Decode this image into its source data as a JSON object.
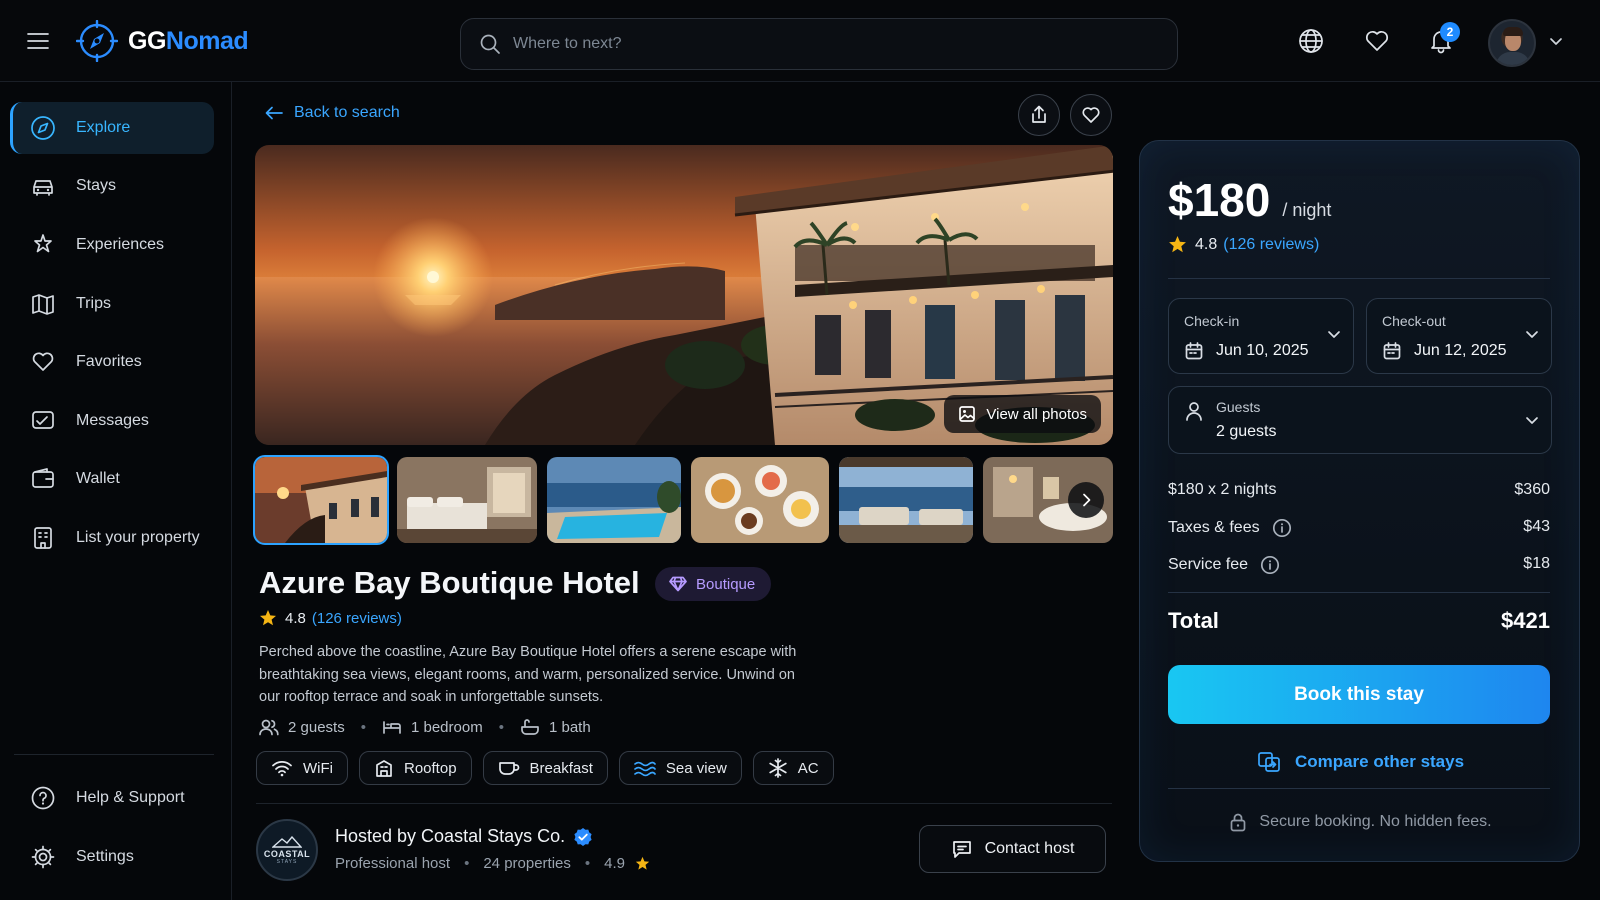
{
  "app": {
    "brand_part1": "GG",
    "brand_part2": "Nomad",
    "accent_color": "#2b8cff"
  },
  "search": {
    "placeholder": "Where to next?",
    "value": ""
  },
  "header": {
    "notification_count": "2",
    "icons": [
      "menu-icon",
      "globe-icon",
      "heart-icon",
      "bell-icon",
      "avatar",
      "chevron-down-icon"
    ]
  },
  "sidebar": {
    "items": [
      {
        "label": "Explore",
        "icon": "compass-icon",
        "active": true
      },
      {
        "label": "Stays",
        "icon": "car-icon"
      },
      {
        "label": "Experiences",
        "icon": "sparkle-icon"
      },
      {
        "label": "Trips",
        "icon": "map-icon"
      },
      {
        "label": "Favorites",
        "icon": "heart-icon"
      },
      {
        "label": "Messages",
        "icon": "message-icon"
      },
      {
        "label": "Wallet",
        "icon": "wallet-icon"
      },
      {
        "label": "List your property",
        "icon": "building-icon"
      }
    ],
    "bottom_items": [
      {
        "label": "Help & Support",
        "icon": "help-icon"
      },
      {
        "label": "Settings",
        "icon": "gear-icon"
      }
    ]
  },
  "listing": {
    "back_label": "Back to search",
    "view_all_label": "View all photos",
    "title": "Azure Bay Boutique Hotel",
    "tag": "Boutique",
    "rating": "4.8",
    "reviews": "(126 reviews)",
    "description": "Perched above the coastline, Azure Bay Boutique Hotel offers a serene escape with breathtaking sea views, elegant rooms, and warm, personalized service. Unwind on our rooftop terrace and soak in unforgettable sunsets.",
    "facts": {
      "guests": "2 guests",
      "bedroom": "1 bedroom",
      "bath": "1 bath"
    },
    "amenities": [
      "WiFi",
      "Rooftop",
      "Breakfast",
      "Sea view",
      "AC"
    ],
    "thumbnails": [
      "hotel-exterior-sunset",
      "bedroom",
      "pool-sea",
      "breakfast",
      "terrace-lounge",
      "bathroom"
    ]
  },
  "host": {
    "name": "Hosted by Coastal Stays Co.",
    "logo_text": "COASTAL",
    "logo_sub": "STAYS",
    "type": "Professional host",
    "properties": "24 properties",
    "rating": "4.9",
    "contact_label": "Contact host"
  },
  "booking": {
    "price": "$180",
    "unit": "/ night",
    "rating": "4.8",
    "reviews": "(126 reviews)",
    "checkin_label": "Check-in",
    "checkin_value": "Jun 10, 2025",
    "checkout_label": "Check-out",
    "checkout_value": "Jun 12, 2025",
    "guests_label": "Guests",
    "guests_value": "2 guests",
    "nights_label": "$180 x 2 nights",
    "nights_value": "$360",
    "taxes_label": "Taxes & fees",
    "taxes_value": "$43",
    "service_label": "Service fee",
    "service_value": "$18",
    "total_label": "Total",
    "total_value": "$421",
    "book_label": "Book this stay",
    "compare_label": "Compare other stays",
    "secure_label": "Secure booking. No hidden fees."
  }
}
